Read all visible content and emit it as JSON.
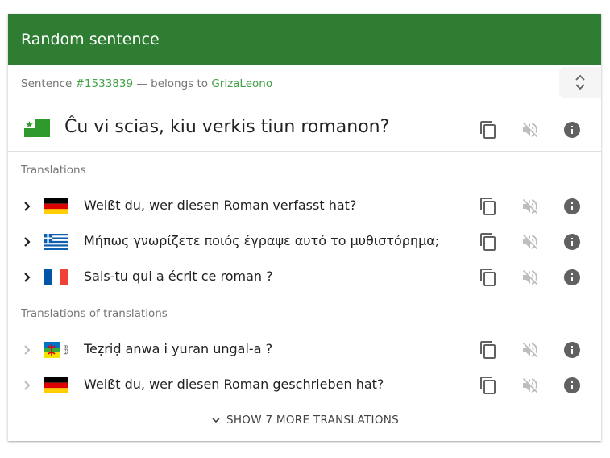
{
  "header": {
    "title": "Random sentence"
  },
  "meta": {
    "prefix": "Sentence ",
    "sentence_id": "#1533839",
    "middle": " — belongs to ",
    "owner": "GrizaLeono"
  },
  "main": {
    "lang": "esperanto",
    "text": "Ĉu vi scias, kiu verkis tiun romanon?"
  },
  "sections": {
    "translations": "Translations",
    "translations_of_translations": "Translations of translations"
  },
  "translations": [
    {
      "lang": "german",
      "text": "Weißt du, wer diesen Roman verfasst hat?"
    },
    {
      "lang": "greek",
      "text": "Μήπως γνωρίζετε ποιός έγραψε αυτό το μυθιστόρημα;"
    },
    {
      "lang": "french",
      "text": "Sais-tu qui a écrit ce roman ?"
    }
  ],
  "indirect": [
    {
      "lang": "berber",
      "flag_label": "BER",
      "text": "Teẓriḍ anwa i yuran ungal-a ?"
    },
    {
      "lang": "german",
      "text": "Weißt du, wer diesen Roman geschrieben hat?"
    }
  ],
  "more_button": {
    "label": "SHOW 7 MORE TRANSLATIONS"
  },
  "colors": {
    "header_bg": "#2e7d32",
    "link": "#43a047",
    "icon_dark": "#616161",
    "icon_muted": "#bdbdbd"
  }
}
